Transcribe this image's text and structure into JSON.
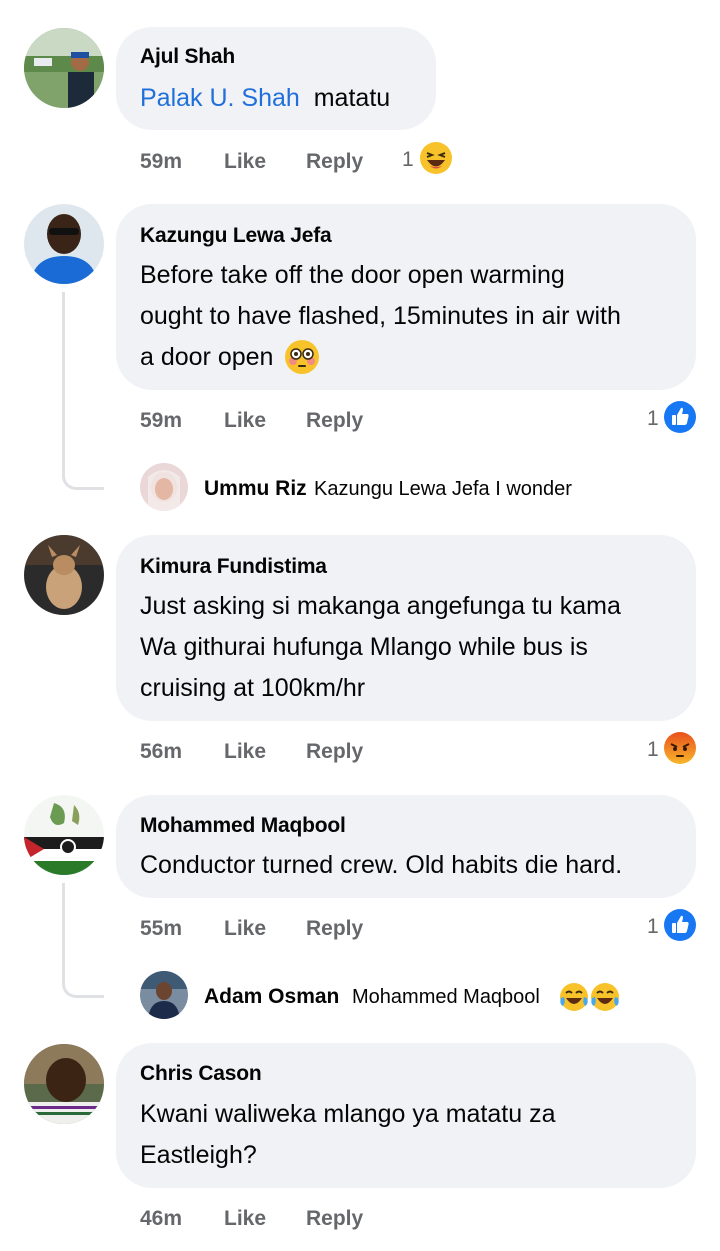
{
  "comments": [
    {
      "author": "Ajul Shah",
      "mention": "Palak U. Shah",
      "text_after_mention": "matatu",
      "time": "59m",
      "like_label": "Like",
      "reply_label": "Reply",
      "reaction_count": "1",
      "reaction_icon": "haha-emoji-icon"
    },
    {
      "author": "Kazungu Lewa Jefa",
      "lines": [
        "Before take off the door open warming",
        "ought to have flashed, 15minutes in air with",
        "a door open"
      ],
      "emoji": "flushed-face-emoji",
      "time": "59m",
      "like_label": "Like",
      "reply_label": "Reply",
      "reaction_count": "1",
      "reaction_icon": "like-thumb-icon",
      "reply": {
        "author": "Ummu Riz",
        "text": "Kazungu Lewa Jefa I wonder"
      }
    },
    {
      "author": "Kimura Fundistima",
      "lines": [
        "Just asking si makanga angefunga tu kama",
        "Wa githurai hufunga Mlango while bus is",
        "cruising at 100km/hr"
      ],
      "time": "56m",
      "like_label": "Like",
      "reply_label": "Reply",
      "reaction_count": "1",
      "reaction_icon": "angry-emoji-icon"
    },
    {
      "author": "Mohammed Maqbool",
      "lines": [
        "Conductor turned crew. Old habits die hard."
      ],
      "time": "55m",
      "like_label": "Like",
      "reply_label": "Reply",
      "reaction_count": "1",
      "reaction_icon": "like-thumb-icon",
      "reply": {
        "author": "Adam Osman",
        "text": "Mohammed Maqbool",
        "emojis": "laughing-crying-emoji x2"
      }
    },
    {
      "author": "Chris Cason",
      "lines": [
        "Kwani waliweka mlango ya matatu za",
        "Eastleigh?"
      ],
      "time": "46m",
      "like_label": "Like",
      "reply_label": "Reply"
    }
  ],
  "colors": {
    "bubble": "#f0f2f5",
    "mention": "#216fdb",
    "meta": "#65676b",
    "like_blue": "#1877f2",
    "thread_line": "#dfe1e5"
  }
}
